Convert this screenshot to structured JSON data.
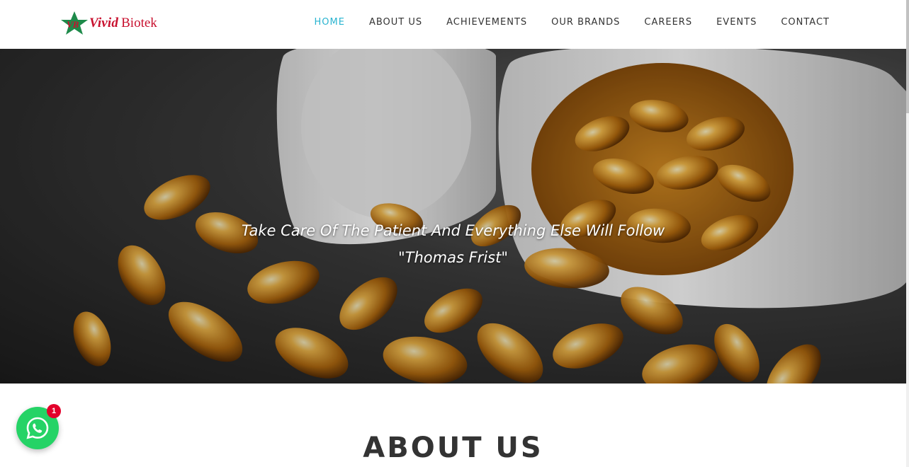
{
  "brand": {
    "logo_mark": "VB",
    "name_part1": "Vivid",
    "name_part2": "Biotek",
    "color": "#c8102e"
  },
  "nav": {
    "active_color": "#2ab4d0",
    "items": [
      {
        "label": "HOME",
        "active": true
      },
      {
        "label": "ABOUT US"
      },
      {
        "label": "ACHIEVEMENTS"
      },
      {
        "label": "OUR BRANDS"
      },
      {
        "label": "CAREERS"
      },
      {
        "label": "EVENTS"
      },
      {
        "label": "CONTACT"
      }
    ]
  },
  "hero": {
    "quote": "Take Care Of The Patient And Everything Else Will Follow",
    "author": "\"Thomas Frist\"",
    "image": "pill-bottle-with-softgel-capsules"
  },
  "about": {
    "title": "ABOUT US"
  },
  "whatsapp": {
    "icon": "whatsapp-icon",
    "badge_count": "1",
    "color": "#25d366"
  }
}
